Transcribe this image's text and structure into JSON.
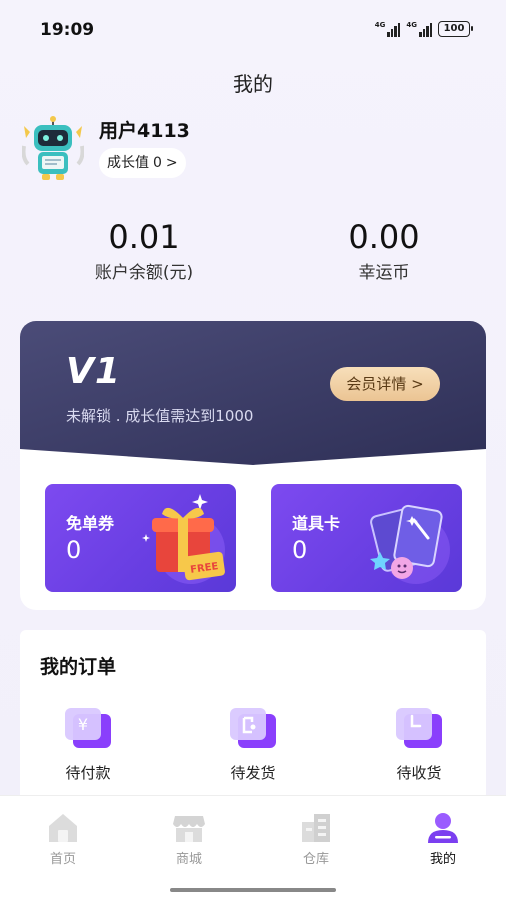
{
  "status_bar": {
    "time": "19:09",
    "net1": "4G",
    "net2": "4G",
    "battery": "100"
  },
  "page": {
    "title": "我的"
  },
  "profile": {
    "username": "用户4113",
    "growth_label": "成长值",
    "growth_value": "0",
    "growth_arrow": ">"
  },
  "stats": [
    {
      "value": "0.01",
      "label": "账户余额(元)"
    },
    {
      "value": "0.00",
      "label": "幸运币"
    }
  ],
  "vip": {
    "level": "V1",
    "description": "未解锁 . 成长值需达到1000",
    "details_button": "会员详情 >",
    "vouchers": [
      {
        "title": "免单券",
        "count": "0",
        "badge": "FREE"
      },
      {
        "title": "道具卡",
        "count": "0"
      }
    ]
  },
  "orders": {
    "title": "我的订单",
    "items": [
      {
        "label": "待付款",
        "icon": "yen-icon"
      },
      {
        "label": "待发货",
        "icon": "package-icon"
      },
      {
        "label": "待收货",
        "icon": "clock-icon"
      }
    ]
  },
  "tabbar": {
    "items": [
      {
        "label": "首页",
        "icon": "home-icon"
      },
      {
        "label": "商城",
        "icon": "store-icon"
      },
      {
        "label": "仓库",
        "icon": "warehouse-icon"
      },
      {
        "label": "我的",
        "icon": "profile-icon",
        "active": true
      }
    ]
  },
  "colors": {
    "accent": "#7b4bf0",
    "vip_bg": "#3a3b66",
    "gold": "#ebc493"
  }
}
